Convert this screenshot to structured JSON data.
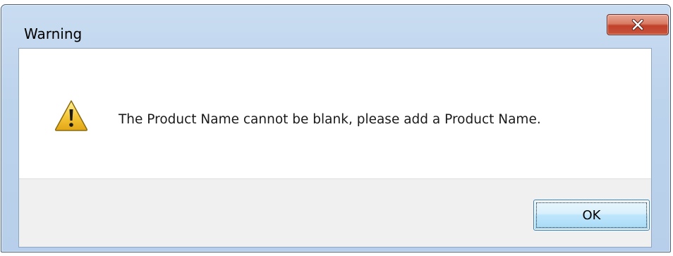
{
  "dialog": {
    "title": "Warning",
    "message": "The Product Name cannot be blank, please add a Product Name.",
    "icon": "warning-icon",
    "ok_label": "OK",
    "close_icon": "close-icon"
  },
  "colors": {
    "title_bar": "#bcd3ec",
    "close_button": "#c8563c",
    "button_area": "#f0f0f0",
    "ok_button_border": "#3c7fb1",
    "warning_yellow": "#f4c430"
  }
}
